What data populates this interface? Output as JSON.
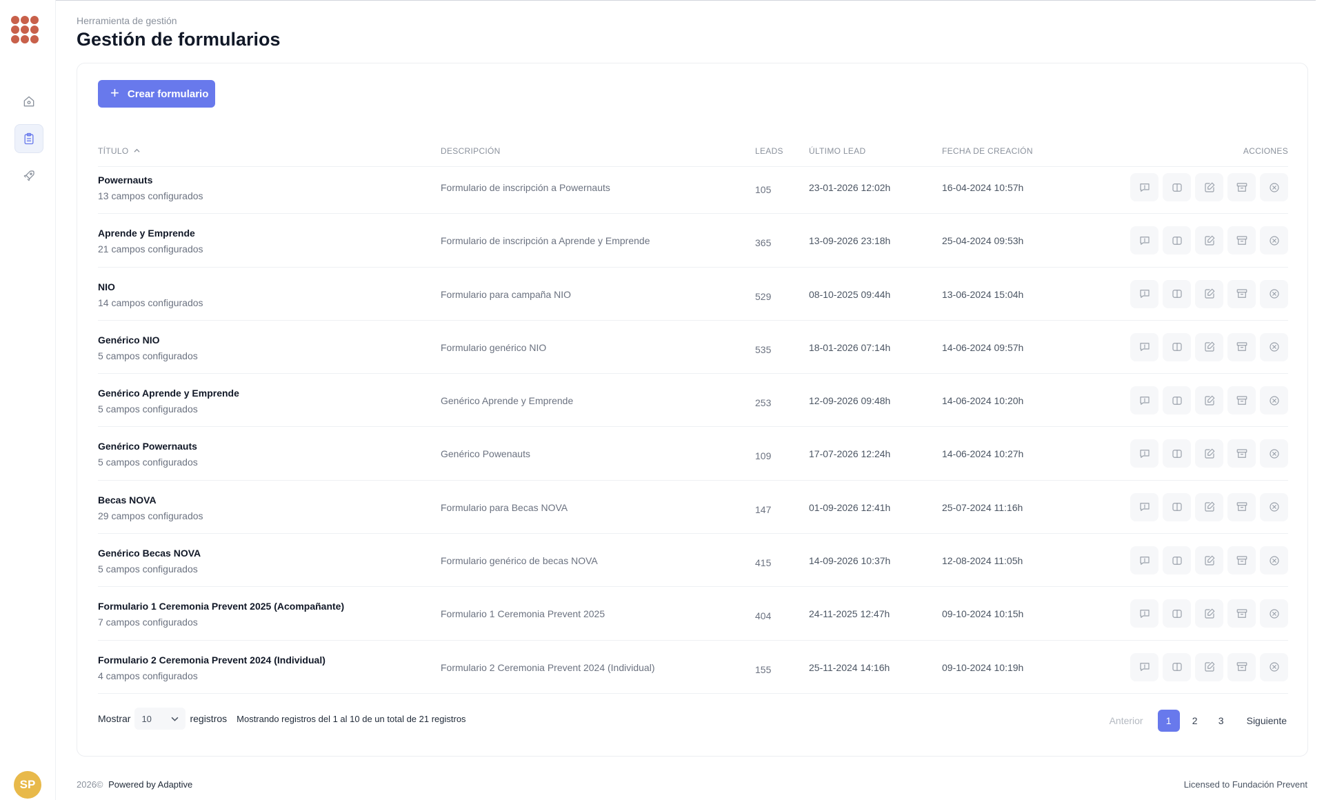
{
  "colors": {
    "accent": "#6879ec",
    "logo": "#c8604a",
    "avatar": "#e8b94a"
  },
  "sidebar": {
    "logo": "dot-grid-logo",
    "items": [
      {
        "icon": "home-icon",
        "active": false
      },
      {
        "icon": "clipboard-icon",
        "active": true
      },
      {
        "icon": "rocket-icon",
        "active": false
      }
    ],
    "avatar_initials": "SP"
  },
  "header": {
    "breadcrumb": "Herramienta de gestión",
    "title": "Gestión de formularios"
  },
  "toolbar": {
    "create_label": "Crear formulario"
  },
  "table": {
    "columns": {
      "title": "TÍTULO",
      "description": "DESCRIPCIÓN",
      "leads": "LEADS",
      "last_lead": "ÚLTIMO LEAD",
      "created": "FECHA DE CREACIÓN",
      "actions": "ACCIONES"
    },
    "sort_icon": "chevron-up-icon",
    "action_icons": [
      "message-alert-icon",
      "columns-icon",
      "edit-icon",
      "archive-icon",
      "close-circle-icon"
    ],
    "rows": [
      {
        "title": "Powernauts",
        "fields": "13 campos configurados",
        "description": "Formulario de inscripción a Powernauts",
        "leads": "105",
        "last_lead": "23-01-2026 12:02h",
        "created": "16-04-2024 10:57h"
      },
      {
        "title": "Aprende y Emprende",
        "fields": "21 campos configurados",
        "description": "Formulario de inscripción a Aprende y Emprende",
        "leads": "365",
        "last_lead": "13-09-2026 23:18h",
        "created": "25-04-2024 09:53h"
      },
      {
        "title": "NIO",
        "fields": "14 campos configurados",
        "description": "Formulario para campaña NIO",
        "leads": "529",
        "last_lead": "08-10-2025 09:44h",
        "created": "13-06-2024 15:04h"
      },
      {
        "title": "Genérico NIO",
        "fields": "5 campos configurados",
        "description": "Formulario genérico NIO",
        "leads": "535",
        "last_lead": "18-01-2026 07:14h",
        "created": "14-06-2024 09:57h"
      },
      {
        "title": "Genérico Aprende y Emprende",
        "fields": "5 campos configurados",
        "description": "Genérico Aprende y Emprende",
        "leads": "253",
        "last_lead": "12-09-2026 09:48h",
        "created": "14-06-2024 10:20h"
      },
      {
        "title": "Genérico Powernauts",
        "fields": "5 campos configurados",
        "description": "Genérico Powenauts",
        "leads": "109",
        "last_lead": "17-07-2026 12:24h",
        "created": "14-06-2024 10:27h"
      },
      {
        "title": "Becas NOVA",
        "fields": "29 campos configurados",
        "description": "Formulario para Becas NOVA",
        "leads": "147",
        "last_lead": "01-09-2026 12:41h",
        "created": "25-07-2024 11:16h"
      },
      {
        "title": "Genérico Becas NOVA",
        "fields": "5 campos configurados",
        "description": "Formulario genérico de becas NOVA",
        "leads": "415",
        "last_lead": "14-09-2026 10:37h",
        "created": "12-08-2024 11:05h"
      },
      {
        "title": "Formulario 1 Ceremonia Prevent 2025 (Acompañante)",
        "fields": "7 campos configurados",
        "description": "Formulario 1 Ceremonia Prevent 2025",
        "leads": "404",
        "last_lead": "24-11-2025 12:47h",
        "created": "09-10-2024 10:15h"
      },
      {
        "title": "Formulario 2 Ceremonia Prevent 2024 (Individual)",
        "fields": "4 campos configurados",
        "description": "Formulario 2 Ceremonia Prevent 2024 (Individual)",
        "leads": "155",
        "last_lead": "25-11-2024 14:16h",
        "created": "09-10-2024 10:19h"
      }
    ]
  },
  "pagination": {
    "show_label": "Mostrar",
    "page_size": "10",
    "records_label": "registros",
    "info": "Mostrando registros del 1 al 10 de un total de 21 registros",
    "prev": "Anterior",
    "pages": [
      "1",
      "2",
      "3"
    ],
    "current": "1",
    "next": "Siguiente"
  },
  "footer": {
    "year": "2026©",
    "powered": "Powered by Adaptive",
    "license": "Licensed to Fundación Prevent"
  }
}
